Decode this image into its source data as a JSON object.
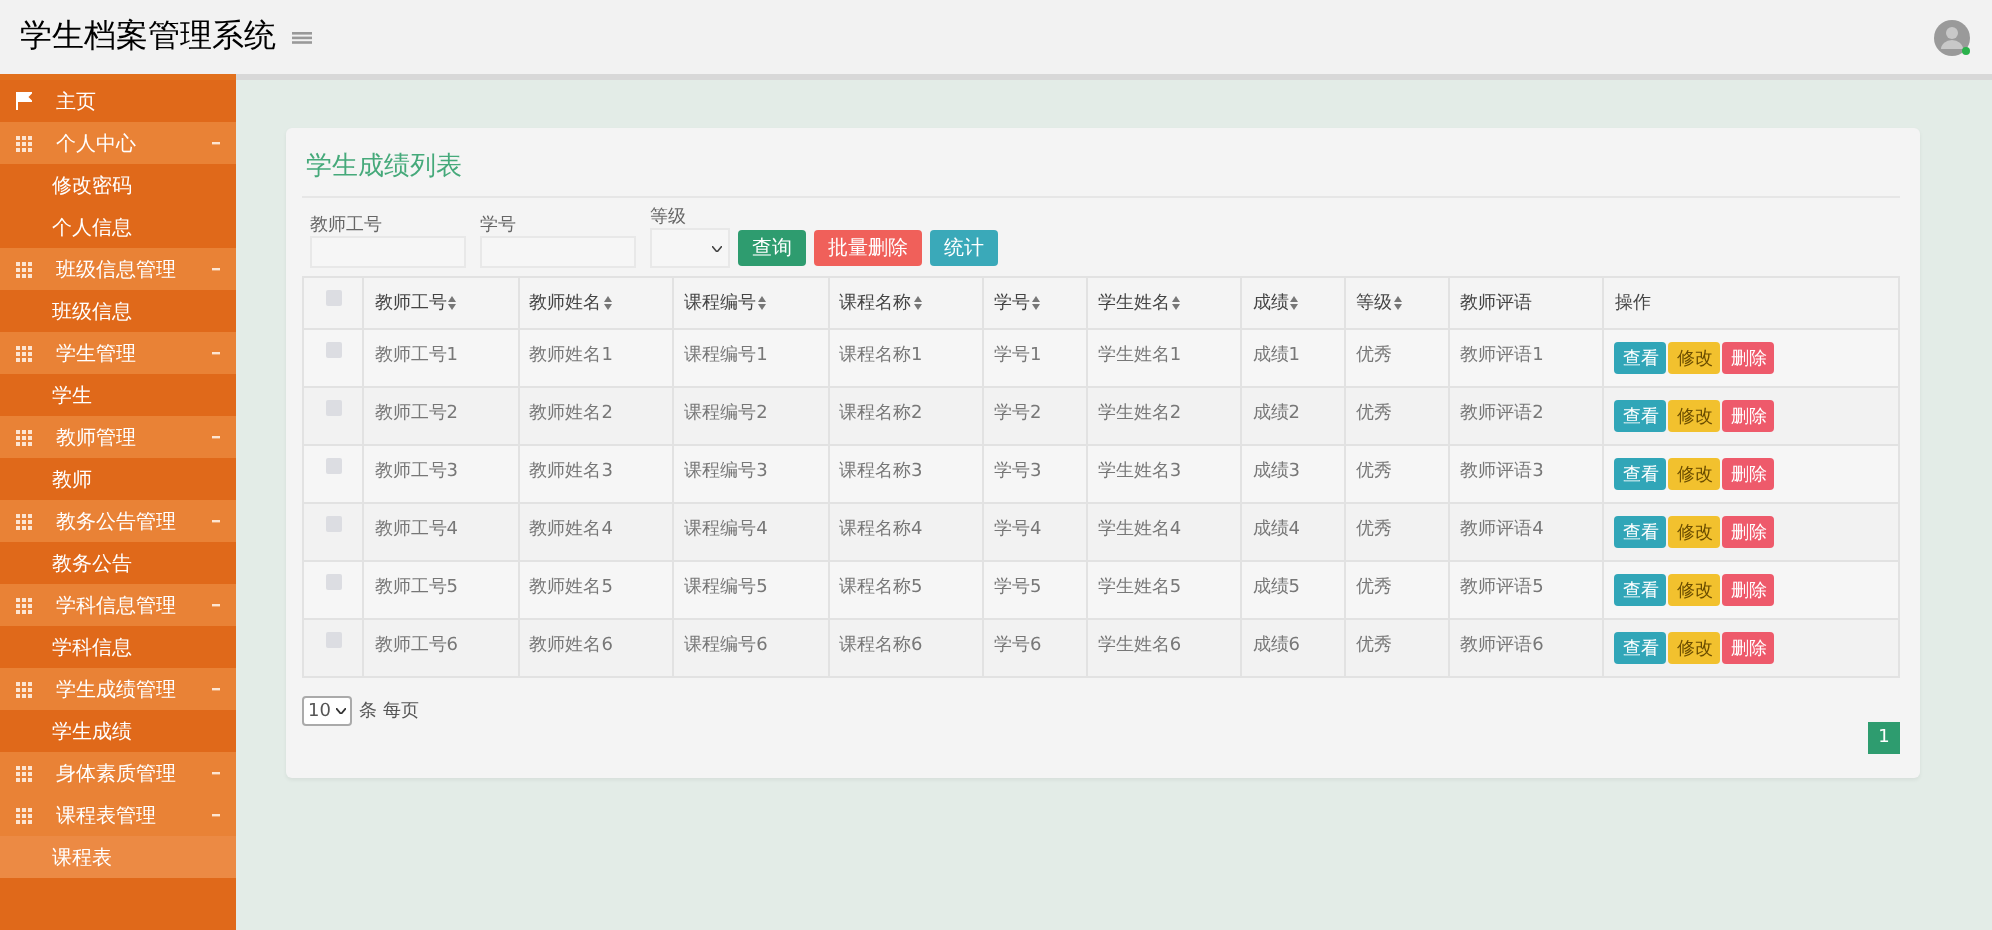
{
  "header": {
    "title": "学生档案管理系统"
  },
  "sidebar": {
    "items": [
      {
        "kind": "link",
        "label": "主页",
        "selected": false
      },
      {
        "kind": "group",
        "label": "个人中心",
        "children": [
          {
            "label": "修改密码",
            "selected": false
          },
          {
            "label": "个人信息",
            "selected": false
          }
        ]
      },
      {
        "kind": "group",
        "label": "班级信息管理",
        "children": [
          {
            "label": "班级信息",
            "selected": false
          }
        ]
      },
      {
        "kind": "group",
        "label": "学生管理",
        "children": [
          {
            "label": "学生",
            "selected": false
          }
        ]
      },
      {
        "kind": "group",
        "label": "教师管理",
        "children": [
          {
            "label": "教师",
            "selected": false
          }
        ]
      },
      {
        "kind": "group",
        "label": "教务公告管理",
        "children": [
          {
            "label": "教务公告",
            "selected": false
          }
        ]
      },
      {
        "kind": "group",
        "label": "学科信息管理",
        "children": [
          {
            "label": "学科信息",
            "selected": false
          }
        ]
      },
      {
        "kind": "group",
        "label": "学生成绩管理",
        "children": [
          {
            "label": "学生成绩",
            "selected": false
          }
        ]
      },
      {
        "kind": "group",
        "label": "身体素质管理"
      },
      {
        "kind": "group",
        "label": "课程表管理",
        "children": [
          {
            "label": "课程表",
            "selected": true
          }
        ]
      }
    ]
  },
  "card": {
    "title": "学生成绩列表",
    "filters": [
      {
        "kind": "text",
        "label": "教师工号"
      },
      {
        "kind": "text",
        "label": "学号"
      },
      {
        "kind": "select",
        "label": "等级"
      }
    ],
    "buttons": [
      {
        "kind": "query",
        "label": "查询"
      },
      {
        "kind": "delete",
        "label": "批量删除"
      },
      {
        "kind": "stats",
        "label": "统计"
      }
    ],
    "table": {
      "select_all_checked": false,
      "columns": [
        {
          "label": "教师工号",
          "sortable": true
        },
        {
          "label": "教师姓名",
          "sortable": true
        },
        {
          "label": "课程编号",
          "sortable": true
        },
        {
          "label": "课程名称",
          "sortable": true
        },
        {
          "label": "学号",
          "sortable": true
        },
        {
          "label": "学生姓名",
          "sortable": true
        },
        {
          "label": "成绩",
          "sortable": true
        },
        {
          "label": "等级",
          "sortable": true
        },
        {
          "label": "教师评语",
          "sortable": false
        },
        {
          "label": "操作",
          "sortable": false
        }
      ],
      "rows": [
        {
          "checked": false,
          "cells": [
            "教师工号1",
            "教师姓名1",
            "课程编号1",
            "课程名称1",
            "学号1",
            "学生姓名1",
            "成绩1",
            "优秀",
            "教师评语1"
          ],
          "actions": [
            "查看",
            "修改",
            "删除"
          ]
        },
        {
          "checked": false,
          "cells": [
            "教师工号2",
            "教师姓名2",
            "课程编号2",
            "课程名称2",
            "学号2",
            "学生姓名2",
            "成绩2",
            "优秀",
            "教师评语2"
          ],
          "actions": [
            "查看",
            "修改",
            "删除"
          ]
        },
        {
          "checked": false,
          "cells": [
            "教师工号3",
            "教师姓名3",
            "课程编号3",
            "课程名称3",
            "学号3",
            "学生姓名3",
            "成绩3",
            "优秀",
            "教师评语3"
          ],
          "actions": [
            "查看",
            "修改",
            "删除"
          ]
        },
        {
          "checked": false,
          "cells": [
            "教师工号4",
            "教师姓名4",
            "课程编号4",
            "课程名称4",
            "学号4",
            "学生姓名4",
            "成绩4",
            "优秀",
            "教师评语4"
          ],
          "actions": [
            "查看",
            "修改",
            "删除"
          ]
        },
        {
          "checked": false,
          "cells": [
            "教师工号5",
            "教师姓名5",
            "课程编号5",
            "课程名称5",
            "学号5",
            "学生姓名5",
            "成绩5",
            "优秀",
            "教师评语5"
          ],
          "actions": [
            "查看",
            "修改",
            "删除"
          ]
        },
        {
          "checked": false,
          "cells": [
            "教师工号6",
            "教师姓名6",
            "课程编号6",
            "课程名称6",
            "学号6",
            "学生姓名6",
            "成绩6",
            "优秀",
            "教师评语6"
          ],
          "actions": [
            "查看",
            "修改",
            "删除"
          ]
        }
      ]
    },
    "page_size": "10",
    "per_page_label": "条 每页",
    "pages": [
      {
        "label": "1",
        "selected": true
      }
    ]
  }
}
